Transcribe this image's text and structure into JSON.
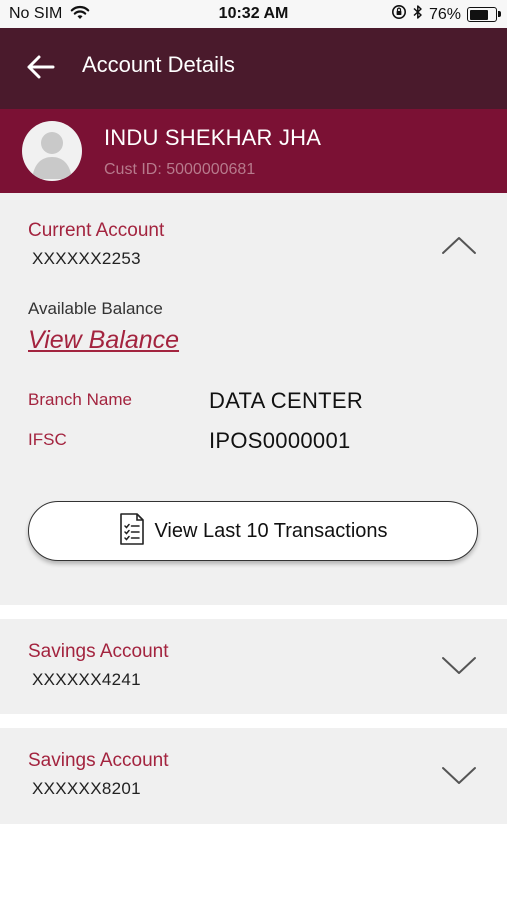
{
  "status_bar": {
    "carrier": "No SIM",
    "time": "10:32 AM",
    "battery": "76%",
    "battery_level": 0.76,
    "icons": [
      "wifi-icon",
      "orientation-lock-icon",
      "bluetooth-icon",
      "battery-icon"
    ]
  },
  "header": {
    "title": "Account Details",
    "back_icon": "back-arrow-icon"
  },
  "profile": {
    "name": "INDU SHEKHAR JHA",
    "cust_id": "Cust ID: 5000000681",
    "avatar_icon": "user-avatar-icon"
  },
  "accounts": [
    {
      "type": "Current Account",
      "number": "XXXXXX2253",
      "expanded": true,
      "available_balance_label": "Available Balance",
      "view_balance": "View Balance",
      "branch_label": "Branch Name",
      "branch_value": "DATA CENTER",
      "ifsc_label": "IFSC",
      "ifsc_value": "IPOS0000001",
      "transactions_button": "View Last 10 Transactions"
    },
    {
      "type": "Savings Account",
      "number": "XXXXXX4241",
      "expanded": false
    },
    {
      "type": "Savings Account",
      "number": "XXXXXX8201",
      "expanded": false
    }
  ],
  "colors": {
    "header_bg": "#4a1a2c",
    "profile_bg": "#7b1134",
    "accent": "#a3243f",
    "card_bg": "#f0f0f0"
  }
}
